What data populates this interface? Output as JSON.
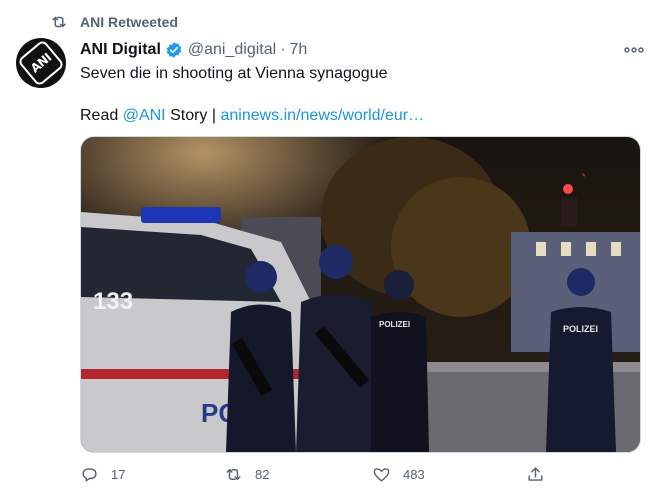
{
  "retweet": {
    "label": "ANI Retweeted"
  },
  "author": {
    "name": "ANI Digital",
    "handle": "@ani_digital",
    "separator": "·",
    "time": "7h",
    "avatar_text": "ANI"
  },
  "tweet": {
    "text": "Seven die in shooting at Vienna synagogue",
    "read_prefix": "Read ",
    "mention": "@ANI",
    "mid": " Story | ",
    "link": "aninews.in/news/world/eur…"
  },
  "media": {
    "vehicle_number": "133",
    "vest_label": "POLIZEI",
    "door_text": "PO"
  },
  "actions": {
    "replies": "17",
    "retweets": "82",
    "likes": "483"
  },
  "colors": {
    "accent": "#1b95e0",
    "muted": "#536471",
    "verified": "#1d9bf0"
  }
}
